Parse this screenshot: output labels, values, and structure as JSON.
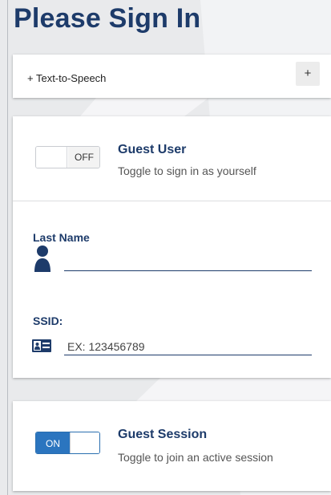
{
  "page": {
    "title": "Please Sign In"
  },
  "tts": {
    "label": "+ Text-to-Speech",
    "button": "+"
  },
  "guest_user": {
    "toggle_state": "OFF",
    "title": "Guest User",
    "description": "Toggle to sign in as yourself"
  },
  "fields": {
    "last_name": {
      "label": "Last Name",
      "value": "",
      "placeholder": "",
      "icon": "user-icon"
    },
    "ssid": {
      "label": "SSID:",
      "value": "",
      "placeholder": "EX: 123456789",
      "icon": "id-card-icon"
    }
  },
  "guest_session": {
    "toggle_state": "ON",
    "title": "Guest Session",
    "description": "Toggle to join an active session"
  },
  "colors": {
    "heading": "#1d3b6a",
    "accent": "#2b75bf",
    "background": "#e9eaec"
  }
}
